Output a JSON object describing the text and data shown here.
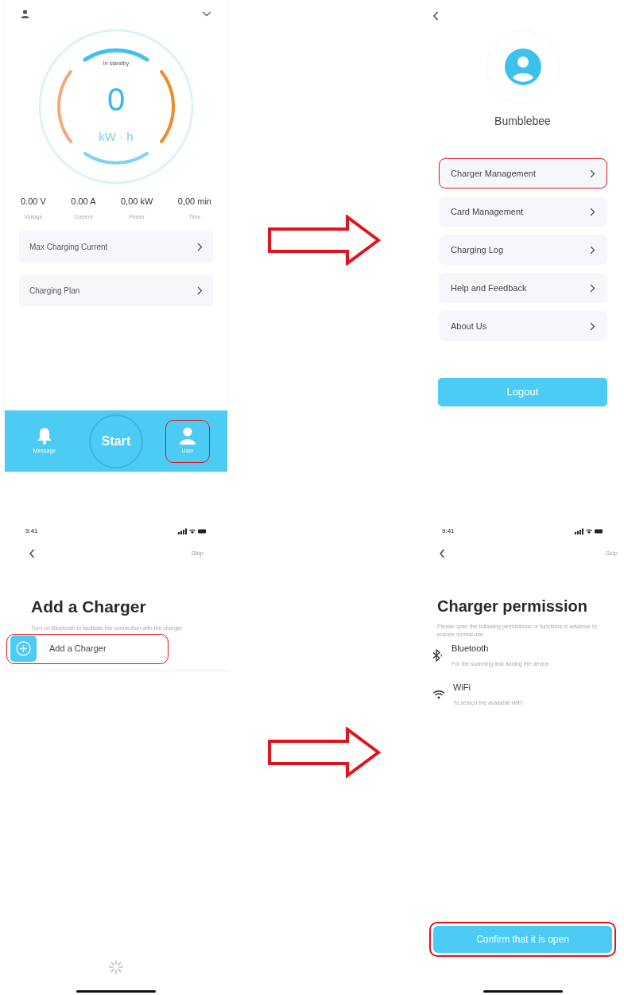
{
  "home": {
    "gauge": {
      "status": "In standby",
      "value": "0",
      "unit": "kW · h"
    },
    "stats": [
      {
        "value": "0.00 V",
        "label": "Voltage"
      },
      {
        "value": "0.00 A",
        "label": "Current"
      },
      {
        "value": "0,00 kW",
        "label": "Power"
      },
      {
        "value": "0,00 min",
        "label": "Time"
      }
    ],
    "menu": [
      {
        "label": "Max Charging Current",
        "highlighted": false
      },
      {
        "label": "Charging Plan",
        "highlighted": false
      }
    ],
    "tabbar": [
      {
        "kind": "message",
        "label": "Message",
        "highlighted": false
      },
      {
        "kind": "start",
        "label": "Start",
        "highlighted": false
      },
      {
        "kind": "user",
        "label": "User",
        "highlighted": true
      }
    ]
  },
  "user": {
    "name": "Bumblebee",
    "menu": [
      {
        "label": "Charger Management",
        "highlighted": true
      },
      {
        "label": "Card Management",
        "highlighted": false
      },
      {
        "label": "Charging Log",
        "highlighted": false
      },
      {
        "label": "Help and Feedback",
        "highlighted": false
      },
      {
        "label": "About Us",
        "highlighted": false
      }
    ],
    "logout": "Logout"
  },
  "add_charger": {
    "status_bar": {
      "time": "9:41"
    },
    "skip": "Skip",
    "title": "Add a Charger",
    "subtitle": "Turn on Bluetooth to facilitate the connection with the charger",
    "item": {
      "label": "Add a Charger",
      "highlighted": true
    }
  },
  "permission": {
    "status_bar": {
      "time": "9:41"
    },
    "skip": "Skip",
    "title": "Charger permission",
    "subtitle": "Please open the following permissions or functions in advance to ensure normal use",
    "items": [
      {
        "kind": "bluetooth",
        "title": "Bluetooth",
        "description": "For the scanning and adding the device"
      },
      {
        "kind": "wifi",
        "title": "WiFi",
        "description": "To search the available WiFi"
      }
    ],
    "confirm": {
      "label": "Confirm that it is open",
      "highlighted": true
    }
  }
}
